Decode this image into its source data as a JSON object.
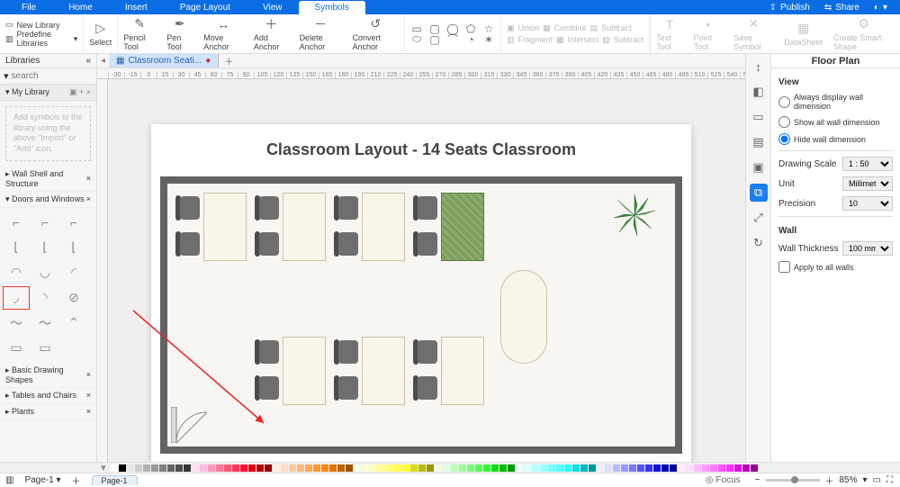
{
  "menu": {
    "file": "File",
    "home": "Home",
    "insert": "Insert",
    "page_layout": "Page Layout",
    "view": "View",
    "symbols": "Symbols",
    "publish": "Publish",
    "share": "Share"
  },
  "ribbon": {
    "new_library": "New Library",
    "predefine": "Predefine Libraries",
    "select": "Select",
    "pencil": "Pencil Tool",
    "pen": "Pen Tool",
    "move": "Move Anchor",
    "add": "Add Anchor",
    "delete": "Delete Anchor",
    "convert": "Convert Anchor",
    "union": "Union",
    "combine": "Combine",
    "subtract": "Subtract",
    "fragment": "Fragment",
    "intersect": "Intersect",
    "subtract2": "Subtract",
    "text_tool": "Text Tool",
    "point_tool": "Point Tool",
    "save_symbol": "Save Symbol",
    "datasheet": "DataSheet",
    "smart_shape": "Create Smart Shape"
  },
  "left": {
    "title": "Libraries",
    "search_placeholder": "search",
    "my_library": "My Library",
    "hint": "Add symbols to the library using the above \"Import\" or \"Add\" icon.",
    "sections": {
      "wall": "Wall Shell and Structure",
      "doors": "Doors and Windows",
      "basic": "Basic Drawing Shapes",
      "tables": "Tables and Chairs",
      "plants": "Plants"
    }
  },
  "doctab": "Classroom Seati...",
  "canvas_title": "Classroom Layout - 14 Seats Classroom",
  "right": {
    "title": "Floor Plan",
    "view": "View",
    "opt_always": "Always display wall dimension",
    "opt_show": "Show all wall dimension",
    "opt_hide": "Hide wall dimension",
    "drawing_scale": "Drawing Scale",
    "scale_val": "1 : 50",
    "unit": "Unit",
    "unit_val": "Millimet...",
    "precision": "Precision",
    "precision_val": "10",
    "wall": "Wall",
    "wall_thickness": "Wall Thickness",
    "wall_val": "100 mm",
    "apply_all": "Apply to all walls"
  },
  "status": {
    "page_label": "Page-1",
    "pagetab": "Page-1",
    "focus": "Focus",
    "zoom": "85%"
  },
  "ruler_start": -30,
  "ruler_step": 15,
  "ruler_count": 44,
  "swatches": [
    "#fff",
    "#000",
    "#e6e6e6",
    "#ccc",
    "#b3b3b3",
    "#999",
    "#808080",
    "#666",
    "#4d4d4d",
    "#333",
    "#fde",
    "#fbd",
    "#f9b",
    "#f79",
    "#f57",
    "#f35",
    "#f13",
    "#d01",
    "#b00",
    "#900",
    "#fed",
    "#fdb",
    "#fc9",
    "#fb7",
    "#fa5",
    "#f93",
    "#f81",
    "#d70",
    "#b60",
    "#950",
    "#ffe",
    "#ffd",
    "#ffb",
    "#ff9",
    "#ff7",
    "#ff5",
    "#ff3",
    "#dd1",
    "#bb0",
    "#990",
    "#efe",
    "#dfd",
    "#bfb",
    "#9f9",
    "#7f7",
    "#5f5",
    "#3f3",
    "#1d1",
    "#0b0",
    "#090",
    "#eff",
    "#dff",
    "#bff",
    "#9ff",
    "#7ff",
    "#5ff",
    "#3ff",
    "#1dd",
    "#0bb",
    "#099",
    "#eef",
    "#ddf",
    "#bbf",
    "#99f",
    "#77f",
    "#55f",
    "#33f",
    "#11d",
    "#00b",
    "#009",
    "#fef",
    "#fdf",
    "#fbf",
    "#f9f",
    "#f7f",
    "#f5f",
    "#f3f",
    "#d1d",
    "#b0b",
    "#909"
  ]
}
